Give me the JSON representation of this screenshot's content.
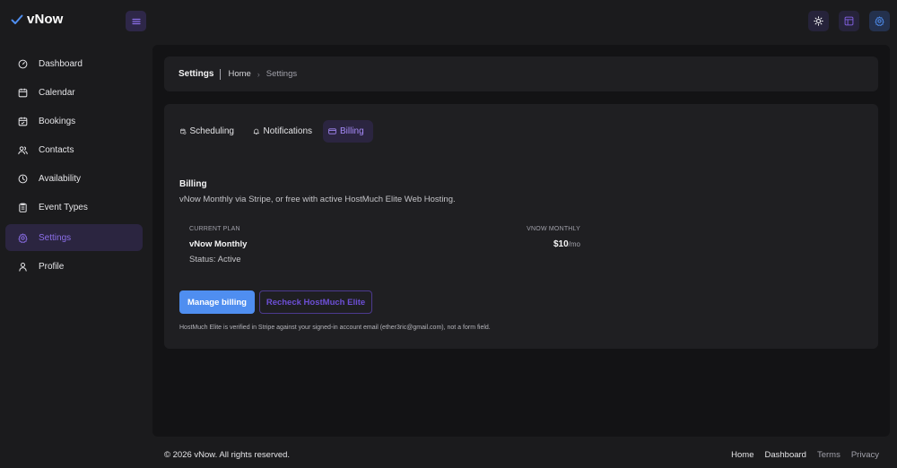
{
  "app": {
    "name": "vNow"
  },
  "colors": {
    "accent": "#8b6ee8",
    "primary_button": "#4f8ef0",
    "active_bg": "#2b2540"
  },
  "header": {
    "icons": [
      "sun-icon",
      "layout-icon",
      "settings-gear-icon"
    ]
  },
  "sidebar": {
    "items": [
      {
        "label": "Dashboard",
        "icon": "gauge-icon"
      },
      {
        "label": "Calendar",
        "icon": "calendar-icon"
      },
      {
        "label": "Bookings",
        "icon": "calendar-check-icon"
      },
      {
        "label": "Contacts",
        "icon": "users-icon"
      },
      {
        "label": "Availability",
        "icon": "clock-icon"
      },
      {
        "label": "Event Types",
        "icon": "clipboard-icon"
      },
      {
        "label": "Settings",
        "icon": "gear-icon",
        "active": true
      },
      {
        "label": "Profile",
        "icon": "user-icon"
      }
    ]
  },
  "breadcrumb": {
    "title": "Settings",
    "home": "Home",
    "current": "Settings"
  },
  "tabs": [
    {
      "label": "Scheduling",
      "icon": "calendar-clock-icon"
    },
    {
      "label": "Notifications",
      "icon": "bell-icon"
    },
    {
      "label": "Billing",
      "icon": "credit-card-icon",
      "active": true
    }
  ],
  "billing": {
    "title": "Billing",
    "description": "vNow Monthly via Stripe, or free with active HostMuch Elite Web Hosting.",
    "current_plan_label": "CURRENT PLAN",
    "plan_name": "vNow Monthly",
    "status": "Status: Active",
    "right_label": "VNOW MONTHLY",
    "price": "$10",
    "period": "/mo",
    "manage_button": "Manage billing",
    "recheck_button": "Recheck HostMuch Elite",
    "note": "HostMuch Elite is verified in Stripe against your signed-in account email (ether3ric@gmail.com), not a form field."
  },
  "footer": {
    "copyright": "© 2026 vNow. All rights reserved.",
    "links": [
      "Home",
      "Dashboard",
      "Terms",
      "Privacy"
    ]
  }
}
